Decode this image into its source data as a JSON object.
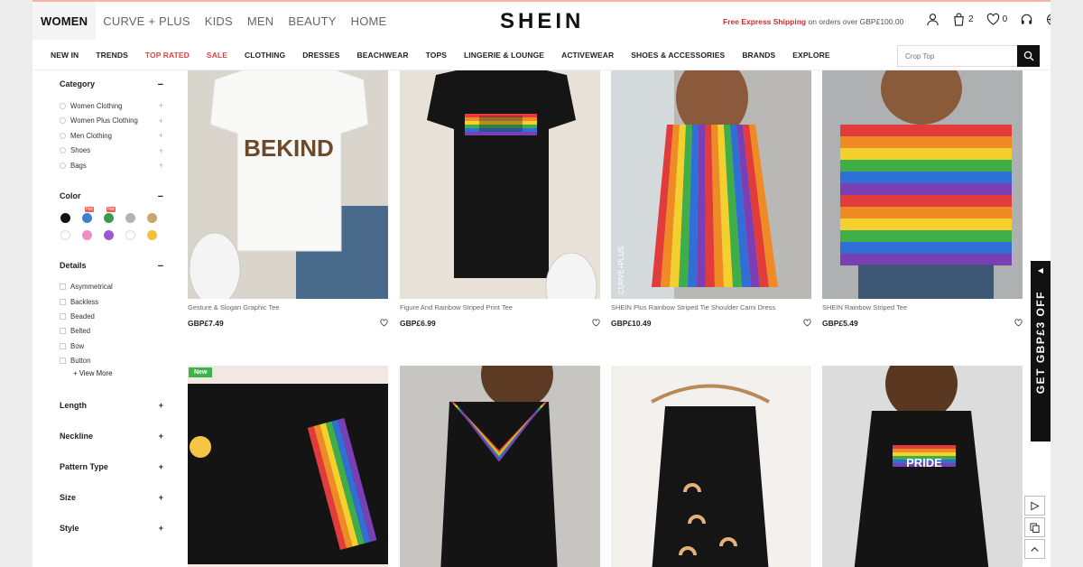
{
  "header": {
    "tabs": [
      "WOMEN",
      "CURVE + PLUS",
      "KIDS",
      "MEN",
      "BEAUTY",
      "HOME"
    ],
    "logo": "SHEIN",
    "promo_highlight": "Free Express Shipping",
    "promo_rest": " on orders over GBP£100.00",
    "cart_count": "2",
    "wish_count": "0"
  },
  "nav": {
    "items": [
      "NEW IN",
      "TRENDS",
      "TOP RATED",
      "SALE",
      "CLOTHING",
      "DRESSES",
      "BEACHWEAR",
      "TOPS",
      "LINGERIE & LOUNGE",
      "ACTIVEWEAR",
      "SHOES & ACCESSORIES",
      "BRANDS",
      "EXPLORE"
    ],
    "highlighted": [
      "TOP RATED",
      "SALE"
    ],
    "highlight_color": "#e0433c"
  },
  "search": {
    "placeholder": "Crop Top"
  },
  "sidebar": {
    "category_title": "Category",
    "categories": [
      "Women Clothing",
      "Women Plus Clothing",
      "Men Clothing",
      "Shoes",
      "Bags"
    ],
    "color_title": "Color",
    "colors": [
      "#111111",
      "#3f7fd0",
      "#3e9a4f",
      "#b3b3b3",
      "#c9a66a",
      "#ffffff",
      "#f08dc3",
      "#9b59d6",
      "#ffffff",
      "#f2c23a"
    ],
    "hot_label": "Hot",
    "details_title": "Details",
    "details": [
      "Asymmetrical",
      "Backless",
      "Beaded",
      "Belted",
      "Bow",
      "Button"
    ],
    "view_more": "+ View More",
    "collapsed": [
      "Length",
      "Neckline",
      "Pattern Type",
      "Size",
      "Style"
    ],
    "expanded_sign": "−",
    "collapsed_sign": "+"
  },
  "products": [
    {
      "title": "Gesture & Slogan Graphic Tee",
      "price": "GBP£7.49",
      "image": "BEKIND"
    },
    {
      "title": "Figure And Rainbow Striped Print Tee",
      "price": "GBP£6.99"
    },
    {
      "title": "SHEIN Plus Rainbow Striped Tie Shoulder Cami Dress",
      "price": "GBP£10.49",
      "image": "CURVE+PLUS"
    },
    {
      "title": "SHEIN Rainbow Striped Tee",
      "price": "GBP£5.49"
    },
    {
      "badge": "New"
    },
    {},
    {},
    {
      "image": "PRIDE"
    }
  ],
  "coupon_tab": "GET GBP£3 OFF",
  "accent": "#111111"
}
